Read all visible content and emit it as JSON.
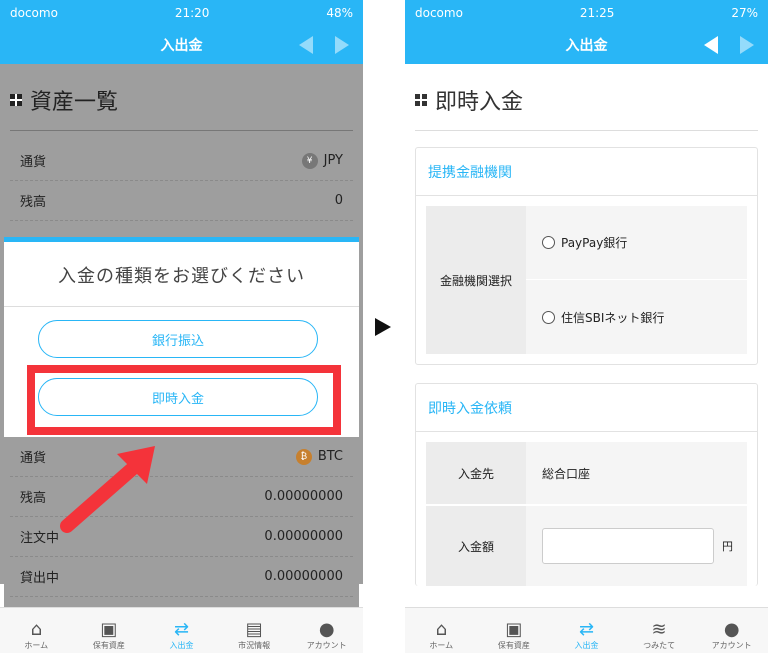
{
  "left": {
    "status": {
      "carrier": "docomo",
      "time": "21:20",
      "battery": "48%"
    },
    "nav_title": "入出金",
    "section_title": "資産一覧",
    "top_rows": [
      {
        "label": "通貨",
        "value": "JPY"
      },
      {
        "label": "残高",
        "value": "0"
      }
    ],
    "modal": {
      "title": "入金の種類をお選びください",
      "bank_transfer": "銀行振込",
      "instant_deposit": "即時入金"
    },
    "bottom_rows": [
      {
        "label": "通貨",
        "value": "BTC"
      },
      {
        "label": "残高",
        "value": "0.00000000"
      },
      {
        "label": "注文中",
        "value": "0.00000000"
      },
      {
        "label": "貸出中",
        "value": "0.00000000"
      }
    ],
    "tabs": [
      "ホーム",
      "保有資産",
      "入出金",
      "市況情報",
      "アカウント"
    ]
  },
  "right": {
    "status": {
      "carrier": "docomo",
      "time": "21:25",
      "battery": "27%"
    },
    "nav_title": "入出金",
    "section_title": "即時入金",
    "bank_card": {
      "title": "提携金融機関",
      "label": "金融機関選択",
      "options": [
        "PayPay銀行",
        "住信SBIネット銀行"
      ]
    },
    "request_card": {
      "title": "即時入金依頼",
      "dest_label": "入金先",
      "dest_value": "総合口座",
      "amount_label": "入金額",
      "amount_unit": "円"
    },
    "tabs": [
      "ホーム",
      "保有資産",
      "入出金",
      "つみたて",
      "アカウント"
    ]
  },
  "colors": {
    "accent": "#29b6f6",
    "highlight": "#f4333a",
    "arrow": "#f4333a"
  }
}
